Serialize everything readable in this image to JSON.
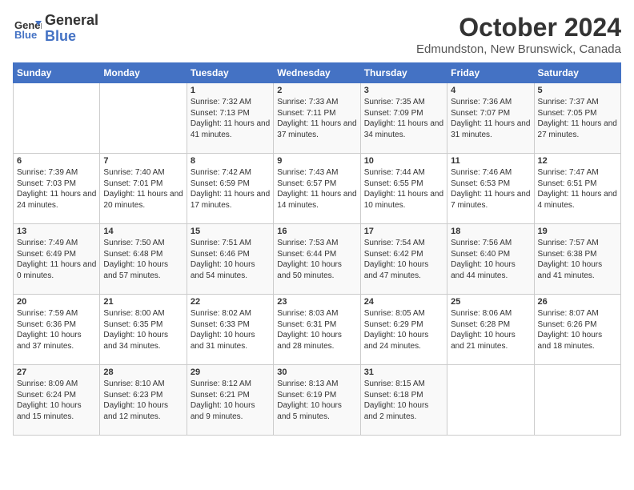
{
  "header": {
    "logo_line1": "General",
    "logo_line2": "Blue",
    "month": "October 2024",
    "location": "Edmundston, New Brunswick, Canada"
  },
  "days_of_week": [
    "Sunday",
    "Monday",
    "Tuesday",
    "Wednesday",
    "Thursday",
    "Friday",
    "Saturday"
  ],
  "weeks": [
    [
      {
        "num": "",
        "info": ""
      },
      {
        "num": "",
        "info": ""
      },
      {
        "num": "1",
        "info": "Sunrise: 7:32 AM\nSunset: 7:13 PM\nDaylight: 11 hours and 41 minutes."
      },
      {
        "num": "2",
        "info": "Sunrise: 7:33 AM\nSunset: 7:11 PM\nDaylight: 11 hours and 37 minutes."
      },
      {
        "num": "3",
        "info": "Sunrise: 7:35 AM\nSunset: 7:09 PM\nDaylight: 11 hours and 34 minutes."
      },
      {
        "num": "4",
        "info": "Sunrise: 7:36 AM\nSunset: 7:07 PM\nDaylight: 11 hours and 31 minutes."
      },
      {
        "num": "5",
        "info": "Sunrise: 7:37 AM\nSunset: 7:05 PM\nDaylight: 11 hours and 27 minutes."
      }
    ],
    [
      {
        "num": "6",
        "info": "Sunrise: 7:39 AM\nSunset: 7:03 PM\nDaylight: 11 hours and 24 minutes."
      },
      {
        "num": "7",
        "info": "Sunrise: 7:40 AM\nSunset: 7:01 PM\nDaylight: 11 hours and 20 minutes."
      },
      {
        "num": "8",
        "info": "Sunrise: 7:42 AM\nSunset: 6:59 PM\nDaylight: 11 hours and 17 minutes."
      },
      {
        "num": "9",
        "info": "Sunrise: 7:43 AM\nSunset: 6:57 PM\nDaylight: 11 hours and 14 minutes."
      },
      {
        "num": "10",
        "info": "Sunrise: 7:44 AM\nSunset: 6:55 PM\nDaylight: 11 hours and 10 minutes."
      },
      {
        "num": "11",
        "info": "Sunrise: 7:46 AM\nSunset: 6:53 PM\nDaylight: 11 hours and 7 minutes."
      },
      {
        "num": "12",
        "info": "Sunrise: 7:47 AM\nSunset: 6:51 PM\nDaylight: 11 hours and 4 minutes."
      }
    ],
    [
      {
        "num": "13",
        "info": "Sunrise: 7:49 AM\nSunset: 6:49 PM\nDaylight: 11 hours and 0 minutes."
      },
      {
        "num": "14",
        "info": "Sunrise: 7:50 AM\nSunset: 6:48 PM\nDaylight: 10 hours and 57 minutes."
      },
      {
        "num": "15",
        "info": "Sunrise: 7:51 AM\nSunset: 6:46 PM\nDaylight: 10 hours and 54 minutes."
      },
      {
        "num": "16",
        "info": "Sunrise: 7:53 AM\nSunset: 6:44 PM\nDaylight: 10 hours and 50 minutes."
      },
      {
        "num": "17",
        "info": "Sunrise: 7:54 AM\nSunset: 6:42 PM\nDaylight: 10 hours and 47 minutes."
      },
      {
        "num": "18",
        "info": "Sunrise: 7:56 AM\nSunset: 6:40 PM\nDaylight: 10 hours and 44 minutes."
      },
      {
        "num": "19",
        "info": "Sunrise: 7:57 AM\nSunset: 6:38 PM\nDaylight: 10 hours and 41 minutes."
      }
    ],
    [
      {
        "num": "20",
        "info": "Sunrise: 7:59 AM\nSunset: 6:36 PM\nDaylight: 10 hours and 37 minutes."
      },
      {
        "num": "21",
        "info": "Sunrise: 8:00 AM\nSunset: 6:35 PM\nDaylight: 10 hours and 34 minutes."
      },
      {
        "num": "22",
        "info": "Sunrise: 8:02 AM\nSunset: 6:33 PM\nDaylight: 10 hours and 31 minutes."
      },
      {
        "num": "23",
        "info": "Sunrise: 8:03 AM\nSunset: 6:31 PM\nDaylight: 10 hours and 28 minutes."
      },
      {
        "num": "24",
        "info": "Sunrise: 8:05 AM\nSunset: 6:29 PM\nDaylight: 10 hours and 24 minutes."
      },
      {
        "num": "25",
        "info": "Sunrise: 8:06 AM\nSunset: 6:28 PM\nDaylight: 10 hours and 21 minutes."
      },
      {
        "num": "26",
        "info": "Sunrise: 8:07 AM\nSunset: 6:26 PM\nDaylight: 10 hours and 18 minutes."
      }
    ],
    [
      {
        "num": "27",
        "info": "Sunrise: 8:09 AM\nSunset: 6:24 PM\nDaylight: 10 hours and 15 minutes."
      },
      {
        "num": "28",
        "info": "Sunrise: 8:10 AM\nSunset: 6:23 PM\nDaylight: 10 hours and 12 minutes."
      },
      {
        "num": "29",
        "info": "Sunrise: 8:12 AM\nSunset: 6:21 PM\nDaylight: 10 hours and 9 minutes."
      },
      {
        "num": "30",
        "info": "Sunrise: 8:13 AM\nSunset: 6:19 PM\nDaylight: 10 hours and 5 minutes."
      },
      {
        "num": "31",
        "info": "Sunrise: 8:15 AM\nSunset: 6:18 PM\nDaylight: 10 hours and 2 minutes."
      },
      {
        "num": "",
        "info": ""
      },
      {
        "num": "",
        "info": ""
      }
    ]
  ]
}
